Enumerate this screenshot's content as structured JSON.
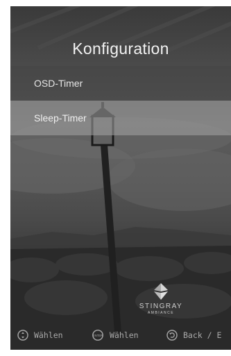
{
  "screen": {
    "title": "Konfiguration",
    "menu": [
      {
        "label": "OSD-Timer",
        "selected": false
      },
      {
        "label": "Sleep-Timer",
        "selected": true
      }
    ],
    "logo": {
      "name": "STINGRAY",
      "sub": "AMBIANCE",
      "icon": "stingray-diamond-logo"
    },
    "footer": {
      "hints": [
        {
          "icon": "dpad-updown-icon",
          "label": "Wählen"
        },
        {
          "icon": "enter-button-icon",
          "icon_text": "ENTER",
          "label": "Wählen"
        },
        {
          "icon": "back-arrow-icon",
          "label": "Back / E"
        }
      ]
    }
  }
}
